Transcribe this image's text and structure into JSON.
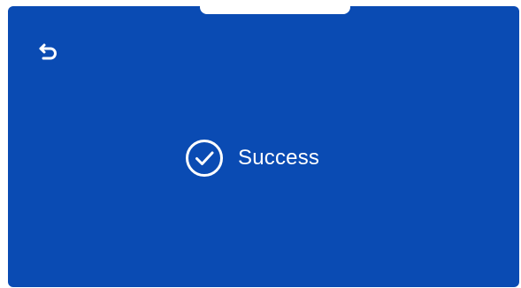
{
  "screen": {
    "back_icon": "back-arrow-icon",
    "status": {
      "icon": "check-circle-icon",
      "text": "Success"
    }
  },
  "colors": {
    "background": "#0a4bb3",
    "foreground": "#ffffff"
  }
}
